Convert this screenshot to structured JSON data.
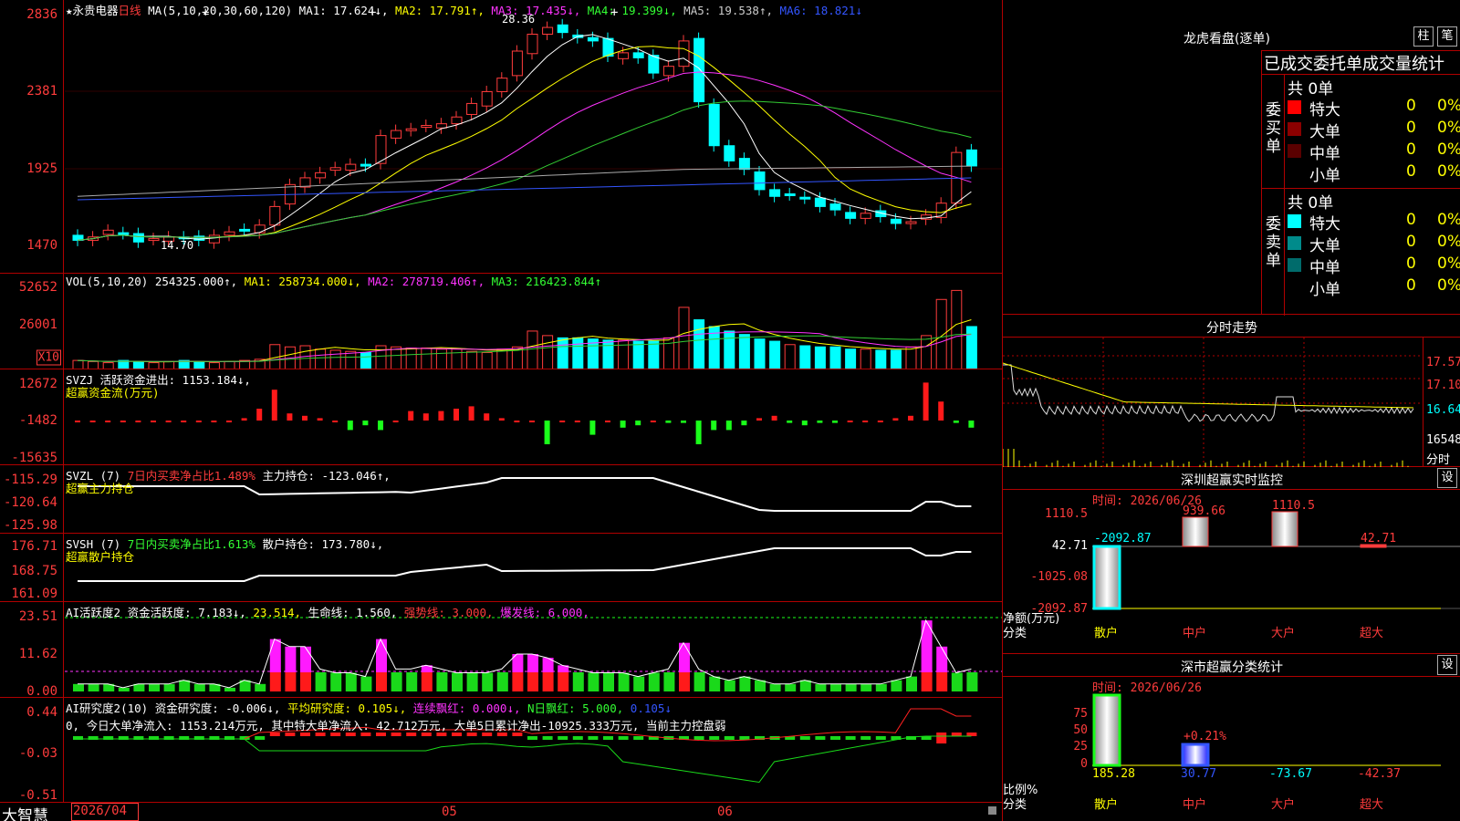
{
  "colors": {
    "up": "#ff3c3c",
    "down": "#00ffff",
    "ma1": "#ffffff",
    "ma2": "#ffff00",
    "ma3": "#ff33ff",
    "ma4": "#33cc33",
    "ma5": "#aaaaaa",
    "ma6": "#3355ff",
    "grid": "#b00000"
  },
  "main": {
    "stock_name": "永贵电器",
    "period": "日线",
    "ma_label": "MA(5,10,20,30,60,120)",
    "ma1": "MA1: 17.624↓,",
    "ma2": "MA2: 17.791↑,",
    "ma3": "MA3: 17.435↓,",
    "ma4": "MA4: 19.399↓,",
    "ma5": "MA5: 19.538↑,",
    "ma6": "MA6: 18.821↓",
    "high_label": "28.36",
    "low_label": "14.70",
    "yticks": [
      "2836",
      "2381",
      "1925",
      "1470"
    ]
  },
  "vol": {
    "label": "VOL(5,10,20)",
    "value": "254325.000↑,",
    "ma1": "MA1: 258734.000↓,",
    "ma2": "MA2: 278719.406↑,",
    "ma3": "MA3: 216423.844↑",
    "yticks": [
      "52652",
      "26001"
    ],
    "unit": "X10"
  },
  "svzj": {
    "line1": "SVZJ  活跃资金进出: 1153.184↓,",
    "line2": "超赢资金流(万元)",
    "yticks": [
      "12672",
      "-1482",
      "-15635"
    ]
  },
  "svzl": {
    "head": "SVZL (7)",
    "pct": "7日内买卖净占比1.489%",
    "val": "主力持仓: -123.046↑,",
    "line2": "超赢主力持仓",
    "yticks": [
      "-115.29",
      "-120.64",
      "-125.98"
    ]
  },
  "svsh": {
    "head": "SVSH (7)",
    "pct": "7日内买卖净占比1.613%",
    "val": "散户持仓: 173.780↓,",
    "line2": "超赢散户持仓",
    "yticks": [
      "176.71",
      "168.75",
      "161.09"
    ]
  },
  "ai2": {
    "head": "AI活跃度2 资金活跃度: 7.183↓,",
    "v1": "23.514,",
    "v2": "生命线: 1.560,",
    "v3": "强势线: 3.000,",
    "v4": "爆发线: 6.000,",
    "yticks": [
      "23.51",
      "11.62",
      "0.00"
    ]
  },
  "ai3": {
    "head": "AI研究度2(10) 资金研究度: -0.006↓,",
    "v1": "平均研究度: 0.105↓,",
    "v2": "连续飘红: 0.000↓,",
    "v3": "N日飘红: 5.000,",
    "v4": "0.105↓",
    "note": "0, 今日大单净流入: 1153.214万元, 其中特大单净流入: 42.712万元, 大单5日累计净出-10925.333万元, 当前主力控盘弱",
    "yticks": [
      "0.44",
      "-0.03",
      "-0.51"
    ]
  },
  "bottom": {
    "brand": "大智慧",
    "date": "2026/04",
    "m05": "05",
    "m06": "06"
  },
  "dragon": {
    "title": "龙虎看盘(逐单)",
    "btn1": "柱",
    "btn2": "笔",
    "tabs": "已成交委托单成交量统计",
    "buy_label": "委买单",
    "sell_label": "委卖单",
    "buy_total": "共 0单",
    "sell_total": "共 0单",
    "buy_rows": [
      {
        "name": "特大",
        "v": "0",
        "p": "0%",
        "c": "#ff0000"
      },
      {
        "name": "大单",
        "v": "0",
        "p": "0%",
        "c": "#8b0000"
      },
      {
        "name": "中单",
        "v": "0",
        "p": "0%",
        "c": "#5a0000"
      },
      {
        "name": "小单",
        "v": "0",
        "p": "0%",
        "c": "#000000"
      }
    ],
    "sell_rows": [
      {
        "name": "特大",
        "v": "0",
        "p": "0%",
        "c": "#00ffff"
      },
      {
        "name": "大单",
        "v": "0",
        "p": "0%",
        "c": "#008b8b"
      },
      {
        "name": "中单",
        "v": "0",
        "p": "0%",
        "c": "#006b6b"
      },
      {
        "name": "小单",
        "v": "0",
        "p": "0%",
        "c": "#000000"
      }
    ]
  },
  "intraday": {
    "title": "分时走势",
    "yticks": [
      "17.57",
      "17.10",
      "16.64",
      "16548",
      "分时"
    ]
  },
  "monitor": {
    "title": "深圳超赢实时监控",
    "btn": "设",
    "time": "时间: 2026/06/26",
    "yticks": [
      "1110.5",
      "42.71",
      "-1025.08",
      "-2092.87"
    ],
    "ylabel": "净额(万元)",
    "xlabel": "分类",
    "cats": [
      "散户",
      "中户",
      "大户",
      "超大"
    ],
    "vals": [
      "-2092.87",
      "939.66",
      "1110.5",
      "42.71"
    ]
  },
  "stats": {
    "title": "深市超赢分类统计",
    "btn": "设",
    "time": "时间: 2026/06/26",
    "yticks": [
      "75",
      "50",
      "25",
      "0"
    ],
    "ylabel": "比例%",
    "xlabel": "分类",
    "cats": [
      "散户",
      "中户",
      "大户",
      "超大"
    ],
    "vals": [
      "185.28",
      "30.77",
      "-73.67",
      "-42.37"
    ],
    "pct_label": "+0.21%"
  }
}
